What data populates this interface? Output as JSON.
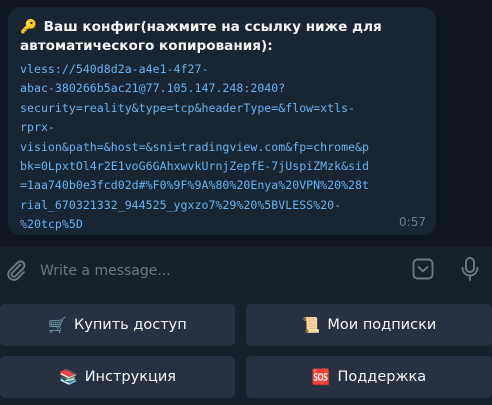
{
  "message": {
    "header_text": "Ваш конфиг(нажмите на ссылку ниже для\nавтоматического копирования):",
    "header_icon": "key-icon",
    "header_emoji": "🔑",
    "config_text": "vless://540d8d2a-a4e1-4f27-\nabac-380266b5ac21@77.105.147.248:2040?\nsecurity=reality&type=tcp&headerType=&flow=xtls-\nrprx-\nvision&path=&host=&sni=tradingview.com&fp=chrome&p\nbk=0LpxtOl4r2E1voG6GAhxwvkUrnjZepfE-7jUspiZMzk&sid\n=1aa740b0e3fcd02d#%F0%9F%9A%80%20Enya%20VPN%20%28t\nrial_670321332_944525_ygxzo7%29%20%5BVLESS%20-\n%20tcp%5D",
    "time": "0:57"
  },
  "composer": {
    "placeholder": "Write a message...",
    "value": ""
  },
  "keyboard": {
    "buttons": [
      {
        "label": "Купить доступ",
        "emoji": "🛒",
        "icon": "cart-icon"
      },
      {
        "label": "Мои подписки",
        "emoji": "📜",
        "icon": "scroll-icon"
      },
      {
        "label": "Инструкция",
        "emoji": "📚",
        "icon": "books-icon"
      },
      {
        "label": "Поддержка",
        "emoji": "🆘",
        "icon": "sos-icon"
      }
    ]
  },
  "colors": {
    "chat_bg": "#0e1621",
    "bubble_bg": "#182533",
    "link": "#6ab3f3",
    "panel_bg": "#17212b",
    "button_bg": "#263241"
  }
}
